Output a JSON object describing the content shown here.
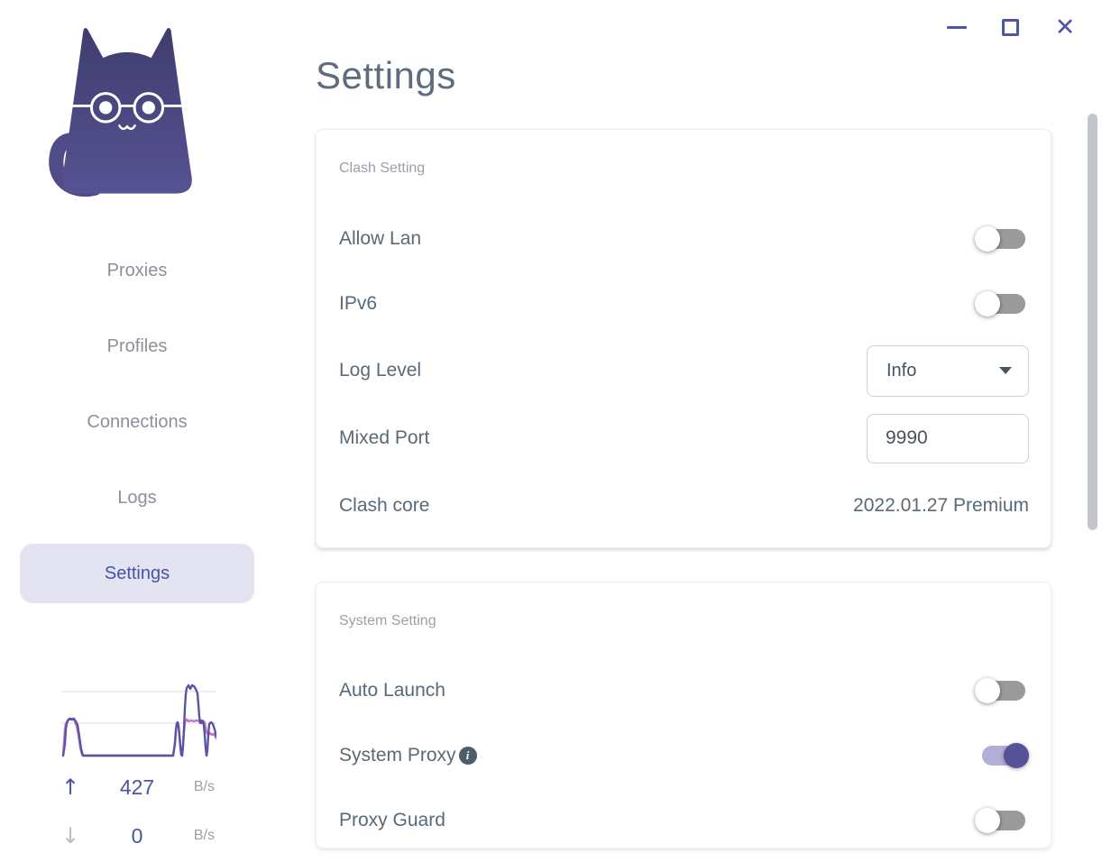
{
  "window": {
    "close_glyph": "✕"
  },
  "sidebar": {
    "nav": [
      {
        "label": "Proxies",
        "active": false
      },
      {
        "label": "Profiles",
        "active": false
      },
      {
        "label": "Connections",
        "active": false
      },
      {
        "label": "Logs",
        "active": false
      },
      {
        "label": "Settings",
        "active": true
      }
    ],
    "traffic": {
      "up_arrow": "↑",
      "up_value": "427",
      "up_unit": "B/s",
      "down_arrow": "↓",
      "down_value": "0",
      "down_unit": "B/s",
      "graph": {
        "width": 172,
        "height": 84,
        "gridlines_y": [
          10,
          45
        ],
        "gridline_color": "#e9e9e9",
        "series": [
          {
            "name": "secondary",
            "color": "#c76fd1",
            "points": [
              [
                2,
                81
              ],
              [
                3,
                66
              ],
              [
                4,
                52
              ],
              [
                5,
                46
              ],
              [
                7,
                42
              ],
              [
                9,
                40
              ],
              [
                11,
                41
              ],
              [
                13,
                40
              ],
              [
                15,
                43
              ],
              [
                17,
                48
              ],
              [
                19,
                58
              ],
              [
                21,
                72
              ],
              [
                23,
                80
              ],
              [
                24,
                81
              ],
              [
                124,
                81
              ],
              [
                126,
                66
              ],
              [
                127,
                52
              ],
              [
                128,
                45
              ],
              [
                129,
                46
              ],
              [
                130,
                50
              ],
              [
                131,
                60
              ],
              [
                132,
                72
              ],
              [
                133,
                80
              ],
              [
                134,
                81
              ],
              [
                135,
                68
              ],
              [
                136,
                54
              ],
              [
                137,
                44
              ],
              [
                139,
                41
              ],
              [
                141,
                43
              ],
              [
                144,
                42
              ],
              [
                147,
                43
              ],
              [
                150,
                42
              ],
              [
                153,
                43
              ],
              [
                156,
                42
              ],
              [
                158,
                43
              ],
              [
                159,
                45
              ],
              [
                160,
                50
              ],
              [
                161,
                55
              ],
              [
                163,
                58
              ],
              [
                165,
                56
              ],
              [
                167,
                58
              ],
              [
                169,
                57
              ],
              [
                171,
                60
              ],
              [
                172,
                62
              ]
            ]
          },
          {
            "name": "primary",
            "color": "#5a55a3",
            "points": [
              [
                2,
                81
              ],
              [
                4,
                68
              ],
              [
                5,
                52
              ],
              [
                6,
                45
              ],
              [
                8,
                41
              ],
              [
                10,
                40
              ],
              [
                12,
                41
              ],
              [
                14,
                40
              ],
              [
                16,
                43
              ],
              [
                18,
                47
              ],
              [
                20,
                60
              ],
              [
                22,
                74
              ],
              [
                24,
                81
              ],
              [
                124,
                81
              ],
              [
                126,
                68
              ],
              [
                127,
                54
              ],
              [
                128,
                46
              ],
              [
                129,
                44
              ],
              [
                130,
                48
              ],
              [
                131,
                58
              ],
              [
                132,
                70
              ],
              [
                133,
                80
              ],
              [
                134,
                81
              ],
              [
                135,
                70
              ],
              [
                136,
                52
              ],
              [
                137,
                28
              ],
              [
                138,
                13
              ],
              [
                139,
                6
              ],
              [
                141,
                3
              ],
              [
                143,
                7
              ],
              [
                145,
                3
              ],
              [
                147,
                4
              ],
              [
                149,
                7
              ],
              [
                151,
                12
              ],
              [
                152,
                24
              ],
              [
                153,
                38
              ],
              [
                154,
                45
              ],
              [
                155,
                42
              ],
              [
                156,
                45
              ],
              [
                157,
                43
              ],
              [
                158,
                47
              ],
              [
                159,
                58
              ],
              [
                160,
                72
              ],
              [
                161,
                81
              ],
              [
                162,
                75
              ],
              [
                163,
                58
              ],
              [
                164,
                46
              ],
              [
                166,
                44
              ],
              [
                168,
                46
              ],
              [
                170,
                52
              ],
              [
                172,
                60
              ]
            ]
          }
        ]
      }
    }
  },
  "main": {
    "title": "Settings",
    "info_glyph": "i",
    "cards": [
      {
        "section": "Clash Setting",
        "rows": [
          {
            "label": "Allow Lan",
            "control": "toggle",
            "state": false
          },
          {
            "label": "IPv6",
            "control": "toggle",
            "state": false
          },
          {
            "label": "Log Level",
            "control": "select",
            "value": "Info"
          },
          {
            "label": "Mixed Port",
            "control": "input",
            "value": "9990"
          },
          {
            "label": "Clash core",
            "control": "text",
            "value": "2022.01.27 Premium"
          }
        ]
      },
      {
        "section": "System Setting",
        "rows": [
          {
            "label": "Auto Launch",
            "control": "toggle",
            "state": false
          },
          {
            "label": "System Proxy",
            "control": "toggle",
            "state": true,
            "info": true
          },
          {
            "label": "Proxy Guard",
            "control": "toggle",
            "state": false
          }
        ]
      }
    ]
  },
  "colors": {
    "accent": "#555298",
    "accent_light": "#b1aed8",
    "toggle_off_track": "#9a9a9a",
    "nav_selected_bg": "#e4e3f2",
    "nav_selected_text": "#4753a5",
    "title_text": "#5d6d7d",
    "label_text": "#5a6976",
    "graph_primary": "#5a55a3",
    "graph_secondary": "#c76fd1"
  }
}
